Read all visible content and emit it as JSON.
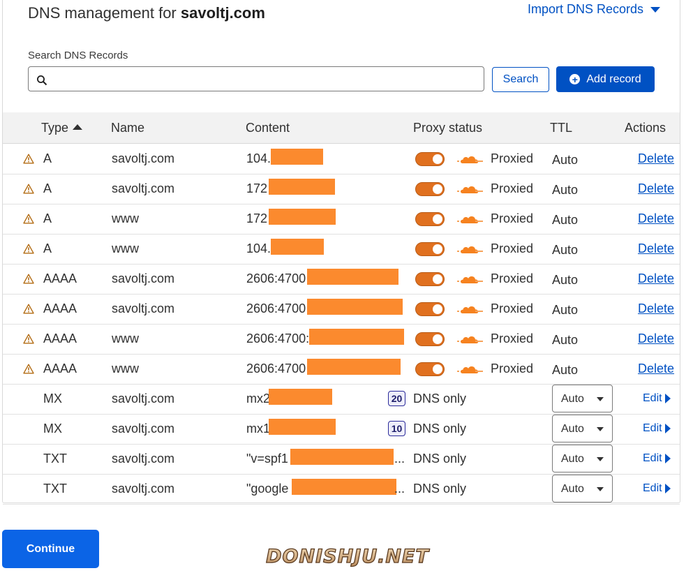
{
  "header": {
    "title_prefix": "DNS management for ",
    "domain": "savoltj.com",
    "import_label": "Import DNS Records"
  },
  "search": {
    "label": "Search DNS Records",
    "placeholder": "",
    "value": "",
    "button_label": "Search"
  },
  "add_button_label": "Add record",
  "columns": {
    "type": "Type",
    "name": "Name",
    "content": "Content",
    "proxy": "Proxy status",
    "ttl": "TTL",
    "actions": "Actions"
  },
  "records": [
    {
      "warning": true,
      "type": "A",
      "name": "savoltj.com",
      "content": "104.",
      "proxy": "Proxied",
      "ttl": "Auto",
      "action": "Delete"
    },
    {
      "warning": true,
      "type": "A",
      "name": "savoltj.com",
      "content": "172",
      "proxy": "Proxied",
      "ttl": "Auto",
      "action": "Delete"
    },
    {
      "warning": true,
      "type": "A",
      "name": "www",
      "content": "172",
      "proxy": "Proxied",
      "ttl": "Auto",
      "action": "Delete"
    },
    {
      "warning": true,
      "type": "A",
      "name": "www",
      "content": "104.",
      "proxy": "Proxied",
      "ttl": "Auto",
      "action": "Delete"
    },
    {
      "warning": true,
      "type": "AAAA",
      "name": "savoltj.com",
      "content": "2606:4700",
      "proxy": "Proxied",
      "ttl": "Auto",
      "action": "Delete"
    },
    {
      "warning": true,
      "type": "AAAA",
      "name": "savoltj.com",
      "content": "2606:4700",
      "proxy": "Proxied",
      "ttl": "Auto",
      "action": "Delete"
    },
    {
      "warning": true,
      "type": "AAAA",
      "name": "www",
      "content": "2606:4700:",
      "proxy": "Proxied",
      "ttl": "Auto",
      "action": "Delete"
    },
    {
      "warning": true,
      "type": "AAAA",
      "name": "www",
      "content": "2606:4700",
      "proxy": "Proxied",
      "ttl": "Auto",
      "action": "Delete"
    },
    {
      "warning": false,
      "type": "MX",
      "name": "savoltj.com",
      "content": "mx2",
      "priority": "20",
      "proxy": "DNS only",
      "ttl": "Auto",
      "action": "Edit"
    },
    {
      "warning": false,
      "type": "MX",
      "name": "savoltj.com",
      "content": "mx1",
      "priority": "10",
      "proxy": "DNS only",
      "ttl": "Auto",
      "action": "Edit"
    },
    {
      "warning": false,
      "type": "TXT",
      "name": "savoltj.com",
      "content": "\"v=spf1",
      "ellipsis": "...",
      "proxy": "DNS only",
      "ttl": "Auto",
      "action": "Edit"
    },
    {
      "warning": false,
      "type": "TXT",
      "name": "savoltj.com",
      "content": "\"google",
      "ellipsis": "...",
      "proxy": "DNS only",
      "ttl": "Auto",
      "action": "Edit"
    }
  ],
  "continue_label": "Continue",
  "watermark": "DONISHJU.NET",
  "colors": {
    "accent": "#0051c3",
    "proxy_orange": "#e0701f",
    "redaction": "#fb8a2e",
    "warning": "#b26b12"
  }
}
